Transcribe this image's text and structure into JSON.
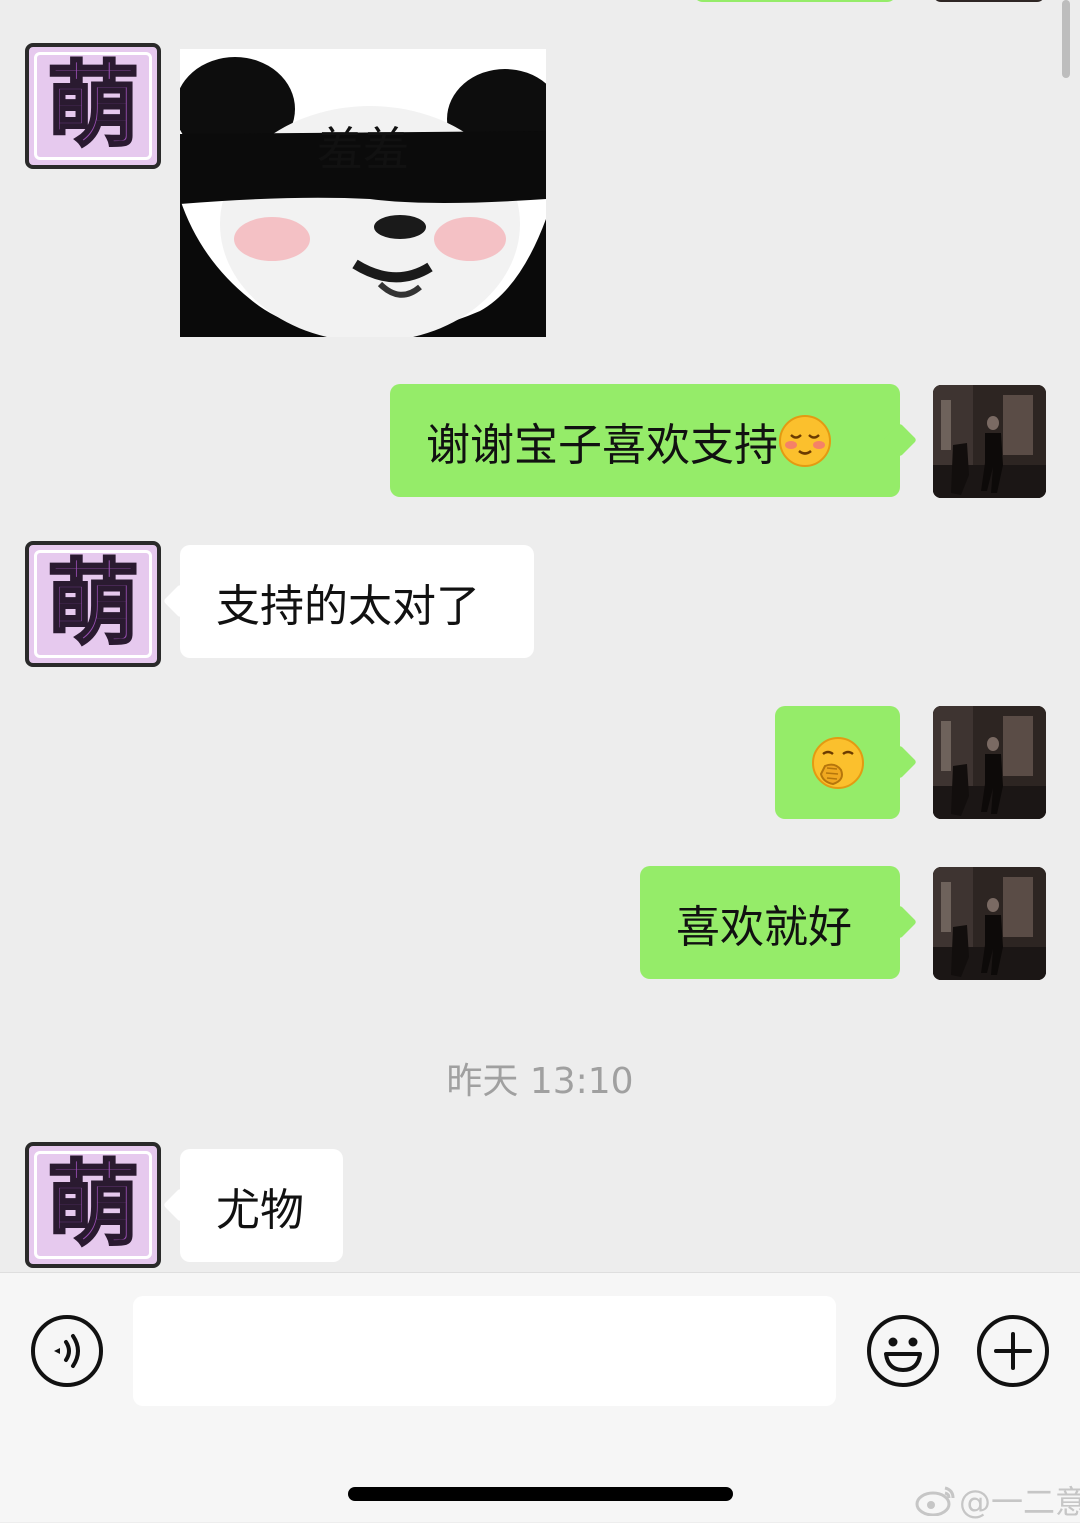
{
  "messages": {
    "sticker_caption": "羞羞",
    "m1_text": "谢谢宝子喜欢支持",
    "m1_emoji": "blushing-smiling-face",
    "m2_text": "支持的太对了",
    "m3_emoji": "face-with-hand-over-mouth",
    "m4_text": "喜欢就好",
    "timestamp": "昨天 13:10",
    "m5_text": "尤物"
  },
  "avatars": {
    "other_glyph": "萌"
  },
  "input_bar": {
    "placeholder": "",
    "voice_icon": "voice-icon",
    "emoji_icon": "emoji-icon",
    "plus_icon": "plus-icon"
  },
  "watermark": {
    "text": "@一二意",
    "icon": "weibo-icon"
  },
  "colors": {
    "background": "#ededed",
    "sent_bubble": "#95ec69",
    "received_bubble": "#ffffff",
    "timestamp": "#a0a0a0"
  }
}
